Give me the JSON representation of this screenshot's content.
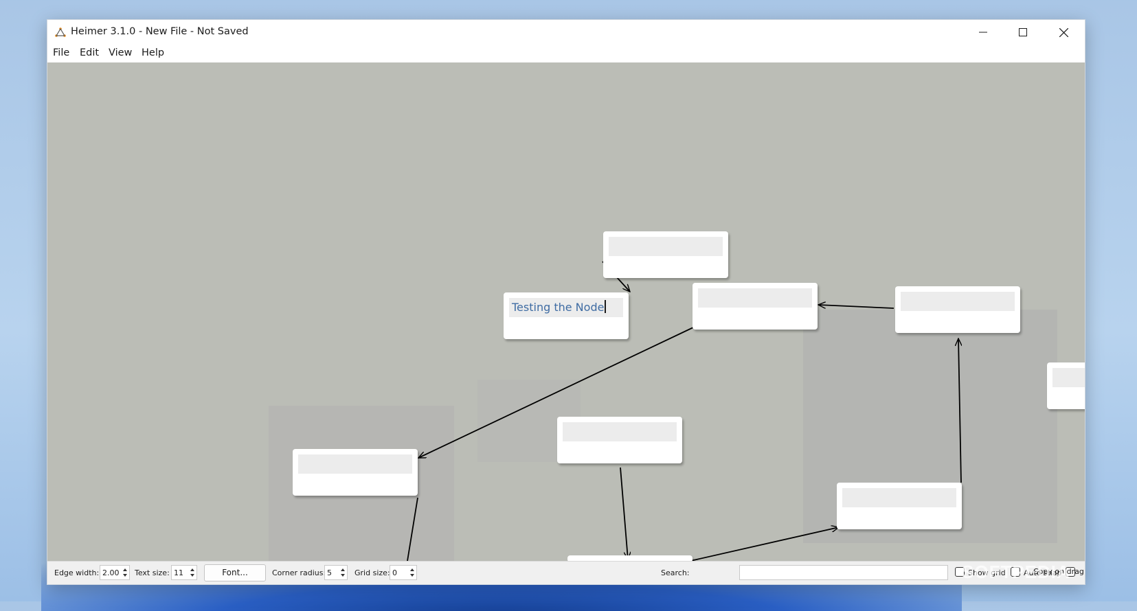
{
  "window": {
    "title": "Heimer 3.1.0 - New File - Not Saved",
    "icon": "heimer-app-icon"
  },
  "menu": {
    "items": [
      "File",
      "Edit",
      "View",
      "Help"
    ]
  },
  "canvas": {
    "editing_node_text": "Testing the Node",
    "node_count": 9
  },
  "toolbar": {
    "edge_width_label": "Edge width:",
    "edge_width_value": "2.00",
    "text_size_label": "Text size:",
    "text_size_value": "11",
    "font_button": "Font...",
    "corner_radius_label": "Corner radius:",
    "corner_radius_value": "5",
    "grid_size_label": "Grid size:",
    "grid_size_value": "0",
    "search_label": "Search:",
    "search_value": "",
    "show_grid_label": "Show grid",
    "show_grid_checked": false,
    "auto_snap_label": "Auto snap",
    "auto_snap_checked": false,
    "copy_on_drag_label": "Copy on drag",
    "copy_on_drag_checked": false
  },
  "colors": {
    "canvas_bg": "#bbbdb6",
    "node_bg": "#ffffff",
    "node_text_bg": "#ececec",
    "node_text_color": "#3f6ca3",
    "edge_color": "#000000"
  },
  "watermark": "SOFTPEDIA"
}
